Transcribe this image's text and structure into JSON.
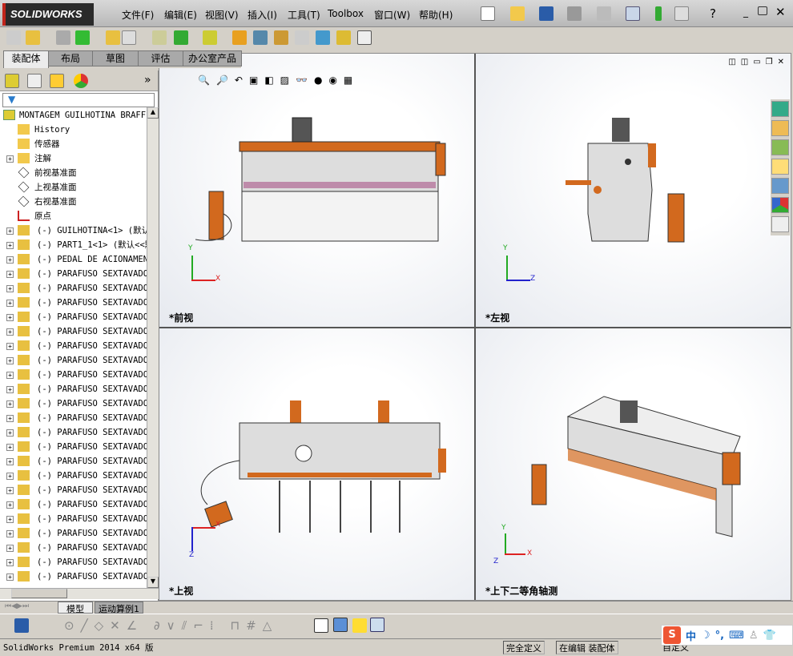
{
  "app": {
    "logo": "SOLIDWORKS"
  },
  "menu": [
    "文件(F)",
    "编辑(E)",
    "视图(V)",
    "插入(I)",
    "工具(T)",
    "Toolbox",
    "窗口(W)",
    "帮助(H)"
  ],
  "command_tabs": [
    "装配体",
    "布局",
    "草图",
    "评估",
    "办公室产品"
  ],
  "tree": {
    "root": "MONTAGEM GUILHOTINA BRAFFE",
    "items": [
      "History",
      "传感器",
      "注解",
      "前视基准面",
      "上视基准面",
      "右视基准面",
      "原点",
      "(-) GUILHOTINA<1> (默认",
      "(-) PART1_1<1> (默认<<默",
      "(-) PEDAL DE ACIONAMENT",
      "(-) PARAFUSO SEXTAVADO",
      "(-) PARAFUSO SEXTAVADO",
      "(-) PARAFUSO SEXTAVADO",
      "(-) PARAFUSO SEXTAVADO",
      "(-) PARAFUSO SEXTAVADO",
      "(-) PARAFUSO SEXTAVADO",
      "(-) PARAFUSO SEXTAVADO",
      "(-) PARAFUSO SEXTAVADO",
      "(-) PARAFUSO SEXTAVADO",
      "(-) PARAFUSO SEXTAVADO",
      "(-) PARAFUSO SEXTAVADO",
      "(-) PARAFUSO SEXTAVADO",
      "(-) PARAFUSO SEXTAVADO",
      "(-) PARAFUSO SEXTAVADO",
      "(-) PARAFUSO SEXTAVADO",
      "(-) PARAFUSO SEXTAVADO",
      "(-) PARAFUSO SEXTAVADO",
      "(-) PARAFUSO SEXTAVADO",
      "(-) PARAFUSO SEXTAVADO",
      "(-) PARAFUSO SEXTAVADO",
      "(-) PARAFUSO SEXTAVADO",
      "(-) PARAFUSO SEXTAVADO"
    ]
  },
  "viewports": [
    "*前视",
    "*左视",
    "*上视",
    "*上下二等角轴测"
  ],
  "axes": {
    "x": "X",
    "y": "Y",
    "z": "Z"
  },
  "bottom_tabs": [
    "模型",
    "运动算例1"
  ],
  "status": {
    "product": "SolidWorks Premium 2014 x64 版",
    "defined": "完全定义",
    "editing": "在编辑 装配体",
    "custom": "自定义"
  },
  "ime": {
    "lang": "中"
  },
  "colors": {
    "machine_orange": "#d2691e",
    "machine_gray": "#d8d8d8",
    "accent_red": "#c0241b"
  }
}
